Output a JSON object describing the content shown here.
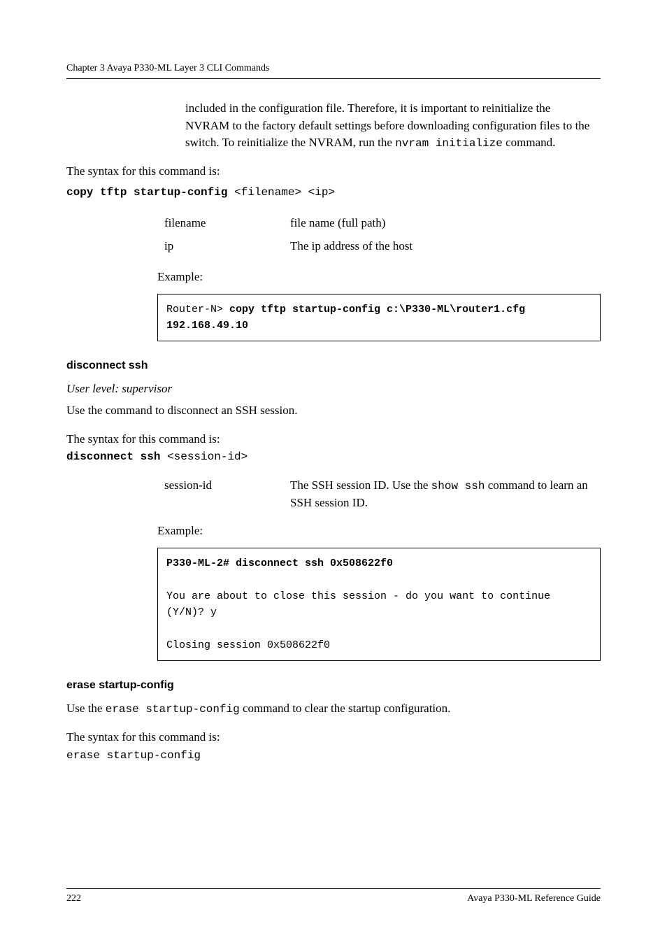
{
  "running_head": "Chapter 3      Avaya P330-ML Layer 3 CLI Commands",
  "intro_para": "included in the configuration file. Therefore, it is important to reinitialize the NVRAM to the factory default settings before downloading configuration files to the switch. To reinitialize the NVRAM, run the ",
  "intro_code": "nvram initialize",
  "intro_tail": " command.",
  "syntax_label": "The syntax for this command is:",
  "copy_cmd_bold": "copy tftp startup-config",
  "copy_cmd_tail": " <filename> <ip>",
  "copy_params": [
    {
      "k": "filename",
      "v": "file name (full path)"
    },
    {
      "k": "ip",
      "v": "The ip address of the host"
    }
  ],
  "example_label": "Example:",
  "copy_example_prefix": "Router-N> ",
  "copy_example_bold": "copy tftp startup-config c:\\P330-ML\\router1.cfg 192.168.49.10",
  "ssh_head": "disconnect ssh",
  "ssh_userlevel": "User level: supervisor",
  "ssh_use": "Use the                                        command to disconnect an SSH session.",
  "ssh_cmd_bold": "disconnect ssh",
  "ssh_cmd_tail": " <session-id>",
  "ssh_param_k": "session-id",
  "ssh_param_v_pre": "The SSH session ID. Use the ",
  "ssh_param_v_code": "show ssh",
  "ssh_param_v_post": " command to learn an SSH session ID.",
  "ssh_example_bold": "P330-ML-2# disconnect ssh 0x508622f0",
  "ssh_example_body": "You are about to close this session - do you want to continue (Y/N)? y\n\nClosing session 0x508622f0",
  "erase_head": "erase startup-config",
  "erase_use_pre": "Use the ",
  "erase_use_code": "erase startup-config",
  "erase_use_post": " command to clear the startup configuration.",
  "erase_cmd": "erase startup-config",
  "footer_page": "222",
  "footer_title": "Avaya P330-ML Reference Guide"
}
